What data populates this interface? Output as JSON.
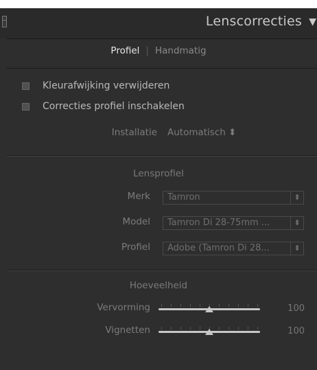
{
  "panel": {
    "title": "Lenscorrecties",
    "collapse_glyph": "▼"
  },
  "tabs": {
    "profiel": "Profiel",
    "separator": "|",
    "handmatig": "Handmatig",
    "active": "Profiel"
  },
  "options": {
    "kleurafwijking_label": "Kleurafwijking verwijderen",
    "kleurafwijking_checked": false,
    "correcties_label": "Correcties profiel inschakelen",
    "correcties_checked": false
  },
  "installatie": {
    "label": "Installatie",
    "value": "Automatisch ⬍"
  },
  "lensprofiel": {
    "title": "Lensprofiel",
    "merk_label": "Merk",
    "merk_value": "Tamron",
    "model_label": "Model",
    "model_value": "Tamron Di 28-75mm ...",
    "profiel_label": "Profiel",
    "profiel_value": "Adobe (Tamron Di 28...",
    "dropdown_arrow": "⬍"
  },
  "hoeveelheid": {
    "title": "Hoeveelheid",
    "vervorming_label": "Vervorming",
    "vervorming_value": "100",
    "vignetten_label": "Vignetten",
    "vignetten_value": "100",
    "slider_min": 0,
    "slider_max": 200
  }
}
